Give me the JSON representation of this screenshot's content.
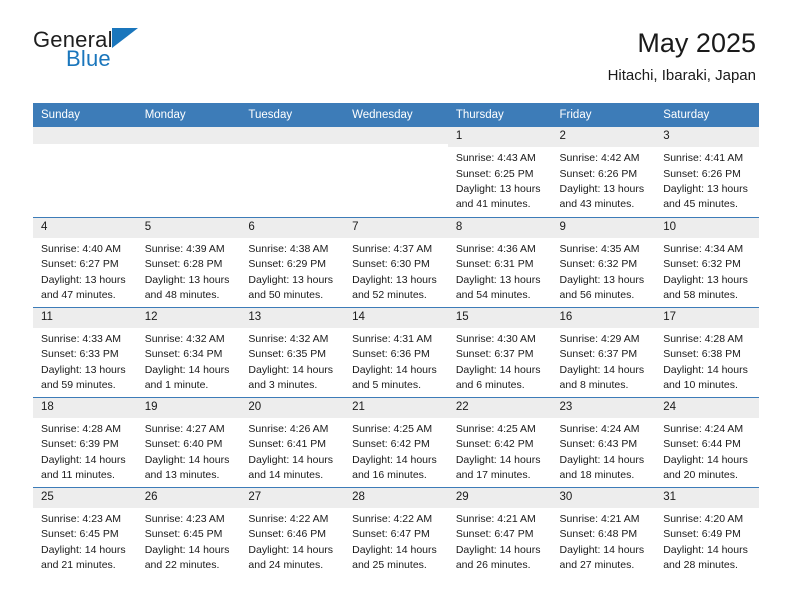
{
  "brand": {
    "word1": "General",
    "word2": "Blue",
    "flag_color": "#1a76bc"
  },
  "header": {
    "title": "May 2025",
    "subtitle": "Hitachi, Ibaraki, Japan"
  },
  "theme": {
    "header_blue": "#3d7cb8",
    "daynum_gray": "#ededed",
    "text": "#1a1a1a"
  },
  "weekday_headers": [
    "Sunday",
    "Monday",
    "Tuesday",
    "Wednesday",
    "Thursday",
    "Friday",
    "Saturday"
  ],
  "weeks": [
    [
      {
        "day": "",
        "empty": true
      },
      {
        "day": "",
        "empty": true
      },
      {
        "day": "",
        "empty": true
      },
      {
        "day": "",
        "empty": true
      },
      {
        "day": "1",
        "sunrise": "Sunrise: 4:43 AM",
        "sunset": "Sunset: 6:25 PM",
        "daylight1": "Daylight: 13 hours",
        "daylight2": "and 41 minutes."
      },
      {
        "day": "2",
        "sunrise": "Sunrise: 4:42 AM",
        "sunset": "Sunset: 6:26 PM",
        "daylight1": "Daylight: 13 hours",
        "daylight2": "and 43 minutes."
      },
      {
        "day": "3",
        "sunrise": "Sunrise: 4:41 AM",
        "sunset": "Sunset: 6:26 PM",
        "daylight1": "Daylight: 13 hours",
        "daylight2": "and 45 minutes."
      }
    ],
    [
      {
        "day": "4",
        "sunrise": "Sunrise: 4:40 AM",
        "sunset": "Sunset: 6:27 PM",
        "daylight1": "Daylight: 13 hours",
        "daylight2": "and 47 minutes."
      },
      {
        "day": "5",
        "sunrise": "Sunrise: 4:39 AM",
        "sunset": "Sunset: 6:28 PM",
        "daylight1": "Daylight: 13 hours",
        "daylight2": "and 48 minutes."
      },
      {
        "day": "6",
        "sunrise": "Sunrise: 4:38 AM",
        "sunset": "Sunset: 6:29 PM",
        "daylight1": "Daylight: 13 hours",
        "daylight2": "and 50 minutes."
      },
      {
        "day": "7",
        "sunrise": "Sunrise: 4:37 AM",
        "sunset": "Sunset: 6:30 PM",
        "daylight1": "Daylight: 13 hours",
        "daylight2": "and 52 minutes."
      },
      {
        "day": "8",
        "sunrise": "Sunrise: 4:36 AM",
        "sunset": "Sunset: 6:31 PM",
        "daylight1": "Daylight: 13 hours",
        "daylight2": "and 54 minutes."
      },
      {
        "day": "9",
        "sunrise": "Sunrise: 4:35 AM",
        "sunset": "Sunset: 6:32 PM",
        "daylight1": "Daylight: 13 hours",
        "daylight2": "and 56 minutes."
      },
      {
        "day": "10",
        "sunrise": "Sunrise: 4:34 AM",
        "sunset": "Sunset: 6:32 PM",
        "daylight1": "Daylight: 13 hours",
        "daylight2": "and 58 minutes."
      }
    ],
    [
      {
        "day": "11",
        "sunrise": "Sunrise: 4:33 AM",
        "sunset": "Sunset: 6:33 PM",
        "daylight1": "Daylight: 13 hours",
        "daylight2": "and 59 minutes."
      },
      {
        "day": "12",
        "sunrise": "Sunrise: 4:32 AM",
        "sunset": "Sunset: 6:34 PM",
        "daylight1": "Daylight: 14 hours",
        "daylight2": "and 1 minute."
      },
      {
        "day": "13",
        "sunrise": "Sunrise: 4:32 AM",
        "sunset": "Sunset: 6:35 PM",
        "daylight1": "Daylight: 14 hours",
        "daylight2": "and 3 minutes."
      },
      {
        "day": "14",
        "sunrise": "Sunrise: 4:31 AM",
        "sunset": "Sunset: 6:36 PM",
        "daylight1": "Daylight: 14 hours",
        "daylight2": "and 5 minutes."
      },
      {
        "day": "15",
        "sunrise": "Sunrise: 4:30 AM",
        "sunset": "Sunset: 6:37 PM",
        "daylight1": "Daylight: 14 hours",
        "daylight2": "and 6 minutes."
      },
      {
        "day": "16",
        "sunrise": "Sunrise: 4:29 AM",
        "sunset": "Sunset: 6:37 PM",
        "daylight1": "Daylight: 14 hours",
        "daylight2": "and 8 minutes."
      },
      {
        "day": "17",
        "sunrise": "Sunrise: 4:28 AM",
        "sunset": "Sunset: 6:38 PM",
        "daylight1": "Daylight: 14 hours",
        "daylight2": "and 10 minutes."
      }
    ],
    [
      {
        "day": "18",
        "sunrise": "Sunrise: 4:28 AM",
        "sunset": "Sunset: 6:39 PM",
        "daylight1": "Daylight: 14 hours",
        "daylight2": "and 11 minutes."
      },
      {
        "day": "19",
        "sunrise": "Sunrise: 4:27 AM",
        "sunset": "Sunset: 6:40 PM",
        "daylight1": "Daylight: 14 hours",
        "daylight2": "and 13 minutes."
      },
      {
        "day": "20",
        "sunrise": "Sunrise: 4:26 AM",
        "sunset": "Sunset: 6:41 PM",
        "daylight1": "Daylight: 14 hours",
        "daylight2": "and 14 minutes."
      },
      {
        "day": "21",
        "sunrise": "Sunrise: 4:25 AM",
        "sunset": "Sunset: 6:42 PM",
        "daylight1": "Daylight: 14 hours",
        "daylight2": "and 16 minutes."
      },
      {
        "day": "22",
        "sunrise": "Sunrise: 4:25 AM",
        "sunset": "Sunset: 6:42 PM",
        "daylight1": "Daylight: 14 hours",
        "daylight2": "and 17 minutes."
      },
      {
        "day": "23",
        "sunrise": "Sunrise: 4:24 AM",
        "sunset": "Sunset: 6:43 PM",
        "daylight1": "Daylight: 14 hours",
        "daylight2": "and 18 minutes."
      },
      {
        "day": "24",
        "sunrise": "Sunrise: 4:24 AM",
        "sunset": "Sunset: 6:44 PM",
        "daylight1": "Daylight: 14 hours",
        "daylight2": "and 20 minutes."
      }
    ],
    [
      {
        "day": "25",
        "sunrise": "Sunrise: 4:23 AM",
        "sunset": "Sunset: 6:45 PM",
        "daylight1": "Daylight: 14 hours",
        "daylight2": "and 21 minutes."
      },
      {
        "day": "26",
        "sunrise": "Sunrise: 4:23 AM",
        "sunset": "Sunset: 6:45 PM",
        "daylight1": "Daylight: 14 hours",
        "daylight2": "and 22 minutes."
      },
      {
        "day": "27",
        "sunrise": "Sunrise: 4:22 AM",
        "sunset": "Sunset: 6:46 PM",
        "daylight1": "Daylight: 14 hours",
        "daylight2": "and 24 minutes."
      },
      {
        "day": "28",
        "sunrise": "Sunrise: 4:22 AM",
        "sunset": "Sunset: 6:47 PM",
        "daylight1": "Daylight: 14 hours",
        "daylight2": "and 25 minutes."
      },
      {
        "day": "29",
        "sunrise": "Sunrise: 4:21 AM",
        "sunset": "Sunset: 6:47 PM",
        "daylight1": "Daylight: 14 hours",
        "daylight2": "and 26 minutes."
      },
      {
        "day": "30",
        "sunrise": "Sunrise: 4:21 AM",
        "sunset": "Sunset: 6:48 PM",
        "daylight1": "Daylight: 14 hours",
        "daylight2": "and 27 minutes."
      },
      {
        "day": "31",
        "sunrise": "Sunrise: 4:20 AM",
        "sunset": "Sunset: 6:49 PM",
        "daylight1": "Daylight: 14 hours",
        "daylight2": "and 28 minutes."
      }
    ]
  ]
}
